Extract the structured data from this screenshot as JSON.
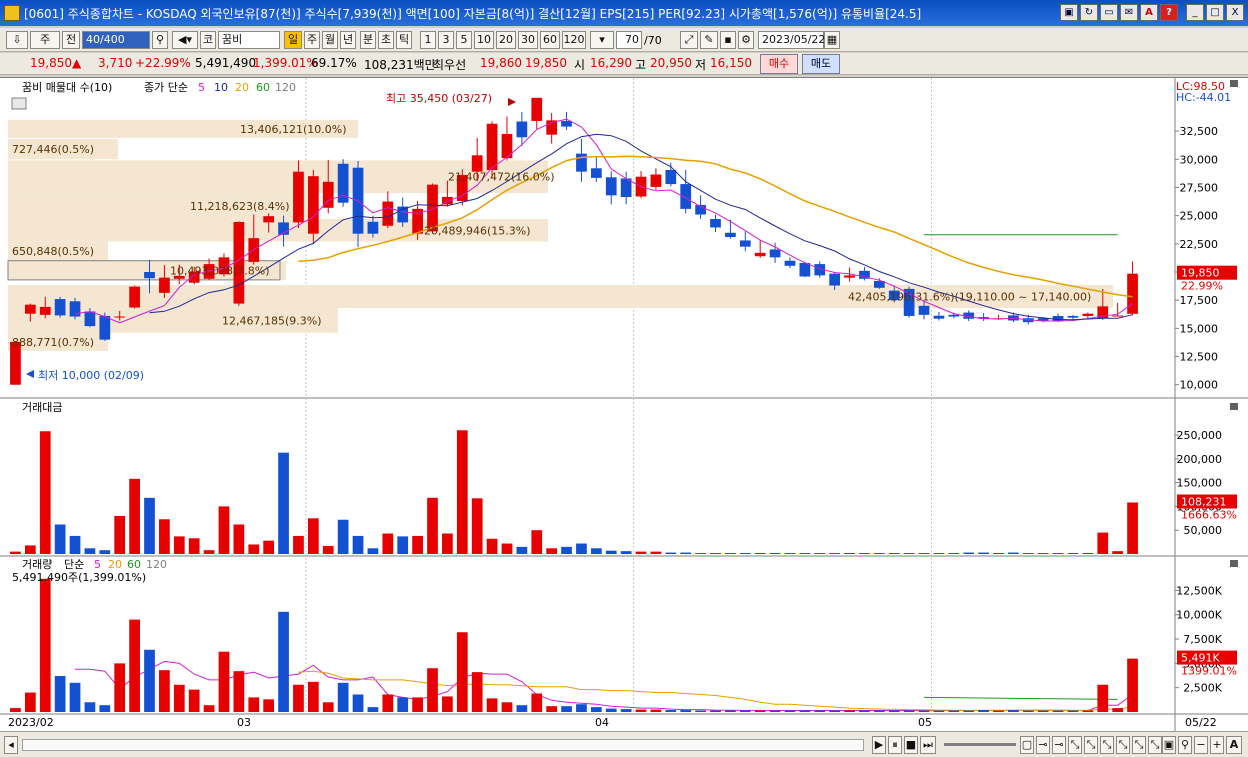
{
  "window": {
    "title": "[0601] 주식종합차트 - KOSDAQ 외국인보유[87(천)] 주식수[7,939(천)] 액면[100] 자본금[8(억)] 결산[12월] EPS[215] PER[92.23] 시가총액[1,576(억)] 유통비율[24.5]",
    "buttons": [
      "screen-icon",
      "refresh-icon",
      "window-icon",
      "mail-icon",
      "A",
      "?",
      "_",
      "□",
      "X"
    ]
  },
  "toolbar": {
    "period_type": "주",
    "compare": "전",
    "count": "40/400",
    "code_prefix": "코",
    "stock_name": "꿈비",
    "periods": [
      "일",
      "주",
      "월",
      "년",
      "분",
      "초",
      "틱"
    ],
    "selected_period": "일",
    "intervals": [
      "1",
      "3",
      "5",
      "10",
      "20",
      "30",
      "60",
      "120"
    ],
    "page": "70",
    "page_total": "/70",
    "date": "2023/05/22"
  },
  "quote": {
    "price": "19,850",
    "direction": "▲",
    "change": "3,710",
    "change_pct": "+22.99%",
    "volume": "5,491,490",
    "volume_ratio": "1,399.01%",
    "turnover": "69.17%",
    "amount": "108,231백만",
    "priority_label": "최우선",
    "bid": "19,860",
    "ask": "19,850",
    "open_label": "시",
    "open": "16,290",
    "high_label": "고",
    "high": "20,950",
    "low_label": "저",
    "low": "16,150",
    "buy_label": "매수",
    "sell_label": "매도"
  },
  "price_panel": {
    "title": "꿈비 매물대 수(10)",
    "ma_label": "종가 단순",
    "ma_periods": [
      "5",
      "10",
      "20",
      "60",
      "120"
    ],
    "lc": "LC:98.50",
    "hc": "HC:-44.01",
    "high_note": "최고 35,450 (03/27)",
    "low_note": "최저 10,000 (02/09)",
    "current_price": "19,850",
    "current_pct": "22.99%",
    "y_ticks": [
      "32,500",
      "30,000",
      "27,500",
      "25,000",
      "22,500",
      "20,000",
      "17,500",
      "15,000",
      "12,500",
      "10,000"
    ],
    "profile_labels": [
      "13,406,121(10.0%)",
      "727,446(0.5%)",
      "11,218,623(8.4%)",
      "21,407,472(16.0%)",
      "20,489,946(15.3%)",
      "650,848(0.5%)",
      "10,493,078(7.8%)",
      "42,405,196(31.6%)(19,110.00 ~ 17,140.00)",
      "12,467,185(9.3%)",
      "888,771(0.7%)"
    ]
  },
  "amount_panel": {
    "title": "거래대금",
    "y_ticks": [
      "250,000",
      "200,000",
      "150,000",
      "100,000",
      "50,000"
    ],
    "current": "108,231",
    "current_pct": "1666.63%"
  },
  "volume_panel": {
    "title": "거래량",
    "ma_label": "단순",
    "ma_periods": [
      "5",
      "20",
      "60",
      "120"
    ],
    "info": "5,491,490주(1,399.01%)",
    "y_ticks": [
      "12,500K",
      "10,000K",
      "7,500K",
      "5,000K",
      "2,500K"
    ],
    "current": "5,491K",
    "current_pct": "1399.01%"
  },
  "x_axis": {
    "labels": [
      "2023/02",
      "03",
      "04",
      "05"
    ],
    "right_label": "05/22"
  },
  "colors": {
    "up": "#e60000",
    "down": "#1450d2",
    "ma5": "#d21ed2",
    "ma10": "#1e2896",
    "ma20": "#e6a000",
    "ma60": "#1e961e",
    "profile": "#f5e6d2"
  },
  "chart_data": {
    "type": "candlestick",
    "x": [
      "02/01",
      "02/02",
      "02/03",
      "02/06",
      "02/07",
      "02/08",
      "02/09",
      "02/10",
      "02/13",
      "02/14",
      "02/15",
      "02/16",
      "02/17",
      "02/20",
      "02/21",
      "02/22",
      "02/23",
      "02/24",
      "02/27",
      "02/28",
      "03/02",
      "03/03",
      "03/06",
      "03/07",
      "03/08",
      "03/09",
      "03/10",
      "03/13",
      "03/14",
      "03/15",
      "03/16",
      "03/17",
      "03/20",
      "03/21",
      "03/22",
      "03/23",
      "03/24",
      "03/27",
      "03/28",
      "03/29",
      "03/30",
      "03/31",
      "04/03",
      "04/04",
      "04/05",
      "04/06",
      "04/07",
      "04/10",
      "04/11",
      "04/12",
      "04/13",
      "04/14",
      "04/17",
      "04/18",
      "04/19",
      "04/20",
      "04/21",
      "04/24",
      "04/25",
      "04/26",
      "04/27",
      "04/28",
      "05/02",
      "05/03",
      "05/04",
      "05/08",
      "05/09",
      "05/10",
      "05/11",
      "05/12",
      "05/15",
      "05/16",
      "05/17",
      "05/18",
      "05/19",
      "05/22"
    ],
    "open": [
      10000,
      16300,
      16200,
      17600,
      17400,
      16500,
      16100,
      16050,
      16850,
      20000,
      18150,
      19400,
      19050,
      19400,
      19800,
      17200,
      20900,
      24400,
      24400,
      24400,
      23400,
      25700,
      29600,
      29250,
      24450,
      24100,
      25800,
      23400,
      23600,
      26000,
      26300,
      28900,
      29050,
      30100,
      33350,
      33400,
      32180,
      33400,
      30500,
      29200,
      28400,
      28300,
      26700,
      27550,
      29050,
      27800,
      25950,
      24700,
      23480,
      22800,
      21400,
      22000,
      21000,
      20800,
      20700,
      19850,
      19500,
      20100,
      19200,
      18350,
      18500,
      17000,
      16120,
      16200,
      16400,
      16000,
      15900,
      16150,
      15900,
      15900,
      16100,
      16100,
      16100,
      15900,
      16100,
      16290
    ],
    "close": [
      13800,
      17100,
      16900,
      16150,
      16050,
      15200,
      14000,
      16050,
      18700,
      19450,
      19500,
      19650,
      20050,
      20700,
      21300,
      24440,
      23000,
      24950,
      23300,
      28900,
      28500,
      28000,
      26150,
      23400,
      23400,
      26250,
      24400,
      25600,
      27750,
      26650,
      28600,
      30350,
      33150,
      32250,
      31950,
      35450,
      33450,
      32900,
      28900,
      28350,
      26800,
      26650,
      28450,
      28650,
      27800,
      25600,
      25100,
      23950,
      23100,
      22250,
      21700,
      21300,
      20550,
      19600,
      19700,
      18800,
      19700,
      19400,
      18600,
      17500,
      16100,
      16200,
      15860,
      16050,
      15850,
      15850,
      15900,
      15700,
      15550,
      15700,
      15650,
      15950,
      16300,
      16950,
      16140,
      19850
    ],
    "high": [
      13800,
      17200,
      17800,
      17800,
      17700,
      16800,
      16400,
      16550,
      18800,
      21050,
      20600,
      20650,
      20450,
      21200,
      21650,
      24500,
      25100,
      25200,
      25000,
      29900,
      29050,
      29950,
      30000,
      29850,
      25000,
      27150,
      26600,
      26300,
      27850,
      28100,
      29100,
      31900,
      33350,
      33800,
      34200,
      35450,
      34100,
      34200,
      31800,
      30300,
      28950,
      28900,
      28950,
      29200,
      29700,
      29050,
      26800,
      25100,
      24650,
      23600,
      22800,
      22600,
      21300,
      20900,
      20950,
      19950,
      20400,
      20450,
      19450,
      18700,
      18700,
      17400,
      16450,
      16400,
      16600,
      16350,
      16200,
      16400,
      16200,
      16000,
      16300,
      16200,
      16400,
      18500,
      17250,
      20950
    ],
    "low": [
      10000,
      15600,
      15900,
      15950,
      15800,
      15100,
      13900,
      15700,
      16750,
      18100,
      17700,
      18900,
      18900,
      19300,
      19600,
      17000,
      20650,
      23500,
      22250,
      23900,
      22500,
      25200,
      25800,
      22200,
      23050,
      23900,
      24000,
      22850,
      23400,
      25800,
      25900,
      28050,
      28400,
      29900,
      31200,
      32650,
      31400,
      32600,
      28000,
      28000,
      26000,
      26000,
      26550,
      27300,
      27600,
      25200,
      24700,
      23550,
      22950,
      21850,
      21250,
      20800,
      20350,
      19550,
      19500,
      18400,
      19150,
      19250,
      18500,
      17300,
      15950,
      15800,
      15700,
      15900,
      15650,
      15650,
      15750,
      15550,
      15350,
      15550,
      15550,
      15750,
      15850,
      15750,
      16050,
      16150
    ],
    "ma5": [
      null,
      null,
      null,
      null,
      16290,
      16490,
      16050,
      15490,
      16010,
      16530,
      17020,
      18630,
      19750,
      20090,
      20320,
      21060,
      21990,
      22740,
      23470,
      24150,
      24900,
      26350,
      26800,
      26300,
      25250,
      25700,
      25330,
      25210,
      25550,
      26260,
      26780,
      27700,
      29250,
      30170,
      31300,
      32650,
      33250,
      33560,
      32870,
      31300,
      29150,
      28290,
      27570,
      27200,
      27270,
      26560,
      25800,
      25240,
      24490,
      23660,
      22830,
      22220,
      21490,
      20820,
      20280,
      19960,
      19830,
      19570,
      19270,
      18750,
      18100,
      17400,
      16850,
      16310,
      16030,
      15870,
      15830,
      15900,
      15760,
      15650,
      15650,
      15700,
      15870,
      16100,
      16260,
      17190
    ],
    "ma10": [
      null,
      null,
      null,
      null,
      null,
      null,
      null,
      null,
      null,
      16390,
      16510,
      16970,
      17620,
      18170,
      18420,
      18850,
      19630,
      20420,
      21230,
      22020,
      22540,
      23650,
      24630,
      24960,
      24810,
      24860,
      25580,
      25970,
      25930,
      25870,
      26200,
      26520,
      27230,
      28030,
      28860,
      29700,
      30480,
      31380,
      32000,
      32220,
      32090,
      31590,
      30740,
      30030,
      29340,
      28010,
      27240,
      26460,
      25930,
      25540,
      24800,
      24080,
      23390,
      22770,
      22340,
      21860,
      21160,
      20640,
      20040,
      19570,
      19050,
      18650,
      18220,
      17840,
      17430,
      17010,
      16640,
      16310,
      16070,
      15930,
      15790,
      15760,
      15830,
      15890,
      15900,
      16210
    ],
    "ma20": [
      null,
      null,
      null,
      null,
      null,
      null,
      null,
      null,
      null,
      null,
      null,
      null,
      null,
      null,
      null,
      null,
      null,
      null,
      null,
      20960,
      21040,
      21270,
      21730,
      22070,
      22370,
      22710,
      23100,
      23490,
      23930,
      24340,
      24810,
      25530,
      26420,
      27260,
      27930,
      28540,
      29260,
      29880,
      30170,
      30240,
      30210,
      30260,
      30220,
      30160,
      30060,
      29910,
      29830,
      29600,
      29130,
      28780,
      28270,
      27620,
      26940,
      26300,
      25830,
      25380,
      24870,
      24410,
      23960,
      23550,
      22980,
      22430,
      21870,
      21300,
      20810,
      20410,
      20050,
      19750,
      19530,
      19290,
      18990,
      18740,
      18480,
      18230,
      17990,
      17810
    ],
    "ma60_level": 23300,
    "amount": [
      5000,
      18000,
      258000,
      62000,
      38000,
      12000,
      8000,
      80000,
      158000,
      118000,
      73000,
      37000,
      33000,
      8000,
      100000,
      62000,
      20000,
      28000,
      213000,
      38000,
      75000,
      17000,
      72000,
      38000,
      12000,
      43000,
      37000,
      38000,
      118000,
      43000,
      260000,
      117000,
      32000,
      22000,
      15000,
      50000,
      12000,
      15000,
      22000,
      12000,
      7000,
      6000,
      5000,
      5000,
      3000,
      3000,
      2000,
      2000,
      2000,
      2000,
      2000,
      2000,
      2000,
      2000,
      2000,
      2000,
      2000,
      2000,
      2000,
      2000,
      2000,
      2000,
      2000,
      2000,
      3000,
      3000,
      2000,
      3000,
      2000,
      2000,
      2000,
      2000,
      2000,
      45000,
      6000,
      108231
    ],
    "volume": [
      400,
      2000,
      13700,
      3700,
      3000,
      1000,
      700,
      5000,
      9500,
      6400,
      4300,
      2800,
      2300,
      700,
      6200,
      4200,
      1500,
      1300,
      10300,
      2800,
      3100,
      1000,
      3000,
      1800,
      500,
      1800,
      1500,
      1500,
      4500,
      1600,
      8200,
      4100,
      1400,
      1000,
      700,
      1900,
      600,
      600,
      800,
      500,
      350,
      300,
      250,
      250,
      200,
      200,
      150,
      150,
      150,
      150,
      150,
      150,
      150,
      150,
      150,
      150,
      150,
      150,
      150,
      150,
      150,
      150,
      150,
      150,
      150,
      200,
      150,
      200,
      150,
      150,
      150,
      150,
      150,
      2800,
      400,
      5491
    ],
    "volume_ma5": [
      null,
      null,
      null,
      null,
      4400,
      4400,
      4200,
      2400,
      3600,
      4400,
      5200,
      5000,
      3900,
      3300,
      3300,
      3800,
      4100,
      3500,
      3700,
      3900,
      4800,
      3600,
      3300,
      3300,
      3600,
      1800,
      1500,
      1300,
      1600,
      2100,
      3500,
      4000,
      3900,
      3900,
      3100,
      1800,
      1200,
      1000,
      900,
      800,
      600,
      500,
      400,
      400,
      300,
      250,
      250,
      200,
      180,
      160,
      160,
      150,
      150,
      150,
      150,
      150,
      150,
      150,
      150,
      150,
      150,
      150,
      150,
      150,
      150,
      160,
      160,
      170,
      170,
      170,
      170,
      160,
      150,
      700,
      700,
      1800
    ],
    "volume_ma20": [
      null,
      null,
      null,
      null,
      null,
      null,
      null,
      null,
      null,
      null,
      null,
      null,
      null,
      null,
      null,
      null,
      null,
      null,
      null,
      4100,
      4200,
      4000,
      3500,
      3400,
      3300,
      3300,
      3300,
      3100,
      2900,
      2700,
      2800,
      2900,
      2800,
      2800,
      2700,
      2600,
      2600,
      2600,
      2300,
      2300,
      2200,
      2200,
      2100,
      2000,
      2000,
      1900,
      1800,
      1700,
      1500,
      1300,
      1000,
      800,
      800,
      700,
      600,
      500,
      400,
      350,
      300,
      280,
      250,
      230,
      200,
      180,
      160,
      160,
      160,
      160,
      160,
      160,
      160,
      160,
      160,
      300,
      300,
      550
    ],
    "y_range": [
      9000,
      36500
    ],
    "amount_range": [
      0,
      290000
    ],
    "volume_range": [
      0,
      14600
    ]
  }
}
